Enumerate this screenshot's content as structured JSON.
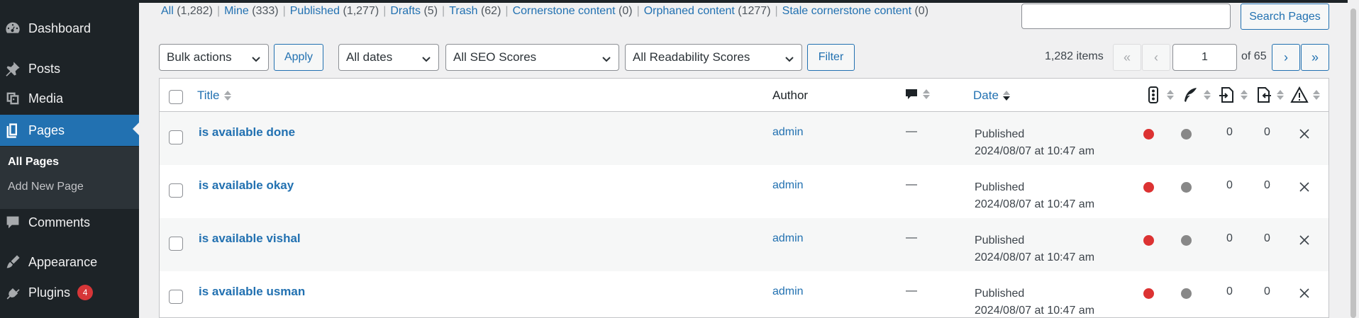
{
  "sidebar": {
    "items": [
      {
        "label": "Dashboard",
        "icon": "dashboard-icon"
      },
      {
        "label": "Posts",
        "icon": "pin-icon"
      },
      {
        "label": "Media",
        "icon": "media-icon"
      },
      {
        "label": "Pages",
        "icon": "pages-icon"
      },
      {
        "label": "Comments",
        "icon": "comment-icon"
      },
      {
        "label": "Appearance",
        "icon": "brush-icon"
      },
      {
        "label": "Plugins",
        "icon": "plug-icon",
        "badge": "4"
      }
    ],
    "submenu": [
      {
        "label": "All Pages"
      },
      {
        "label": "Add New Page"
      }
    ]
  },
  "views": {
    "all": {
      "label": "All",
      "count": "(1,282)"
    },
    "mine": {
      "label": "Mine",
      "count": "(333)"
    },
    "published": {
      "label": "Published",
      "count": "(1,277)"
    },
    "drafts": {
      "label": "Drafts",
      "count": "(5)"
    },
    "trash": {
      "label": "Trash",
      "count": "(62)"
    },
    "cornerstone": {
      "label": "Cornerstone content",
      "count": "(0)"
    },
    "orphaned": {
      "label": "Orphaned content",
      "count": "(1277)"
    },
    "stale": {
      "label": "Stale cornerstone content",
      "count": "(0)"
    },
    "separator": "|"
  },
  "search": {
    "value": "",
    "button_label": "Search Pages"
  },
  "filters": {
    "bulk_actions": "Bulk actions",
    "apply_label": "Apply",
    "dates": "All dates",
    "seo": "All SEO Scores",
    "readability": "All Readability Scores",
    "filter_label": "Filter"
  },
  "pagination": {
    "items": "1,282 items",
    "first": "«",
    "prev": "‹",
    "current_page": "1",
    "of_total": "of 65",
    "next": "›",
    "last": "»"
  },
  "table": {
    "headers": {
      "title": "Title",
      "author": "Author",
      "date": "Date"
    },
    "rows": [
      {
        "title": "is available done",
        "author": "admin",
        "comments": "—",
        "status": "Published",
        "date": "2024/08/07 at 10:47 am",
        "links_out": "0",
        "links_in": "0"
      },
      {
        "title": "is available okay",
        "author": "admin",
        "comments": "—",
        "status": "Published",
        "date": "2024/08/07 at 10:47 am",
        "links_out": "0",
        "links_in": "0"
      },
      {
        "title": "is available vishal",
        "author": "admin",
        "comments": "—",
        "status": "Published",
        "date": "2024/08/07 at 10:47 am",
        "links_out": "0",
        "links_in": "0"
      },
      {
        "title": "is available usman",
        "author": "admin",
        "comments": "—",
        "status": "Published",
        "date": "2024/08/07 at 10:47 am",
        "links_out": "0",
        "links_in": "0"
      }
    ]
  },
  "colors": {
    "sidebar_bg": "#1d2327",
    "accent": "#2271b1",
    "seo_dot": "#dc3232",
    "readability_dot": "#888888",
    "badge": "#d63638"
  }
}
